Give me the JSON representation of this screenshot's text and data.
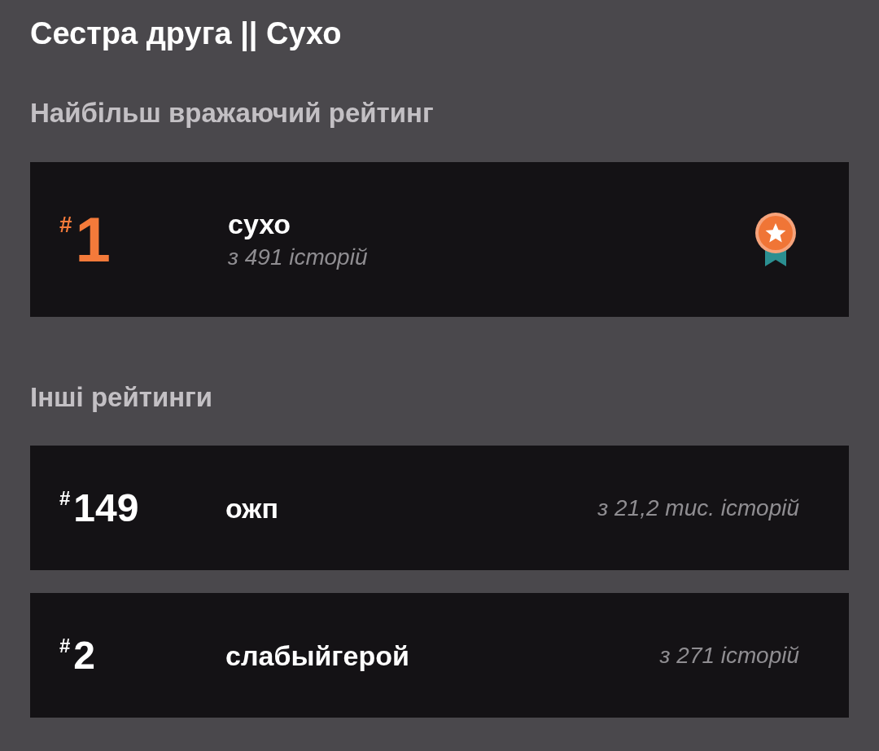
{
  "title": "Сестра друга || Сухо",
  "top_section": {
    "heading": "Найбільш вражаючий рейтинг",
    "ranking": {
      "hash": "#",
      "rank": "1",
      "tag": "сухо",
      "count": "з 491 історій"
    }
  },
  "other_section": {
    "heading": "Інші рейтинги",
    "rankings": [
      {
        "hash": "#",
        "rank": "149",
        "tag": "ожп",
        "count": "з 21,2 тис. історій"
      },
      {
        "hash": "#",
        "rank": "2",
        "tag": "слабыйгерой",
        "count": "з 271 історій"
      }
    ]
  }
}
